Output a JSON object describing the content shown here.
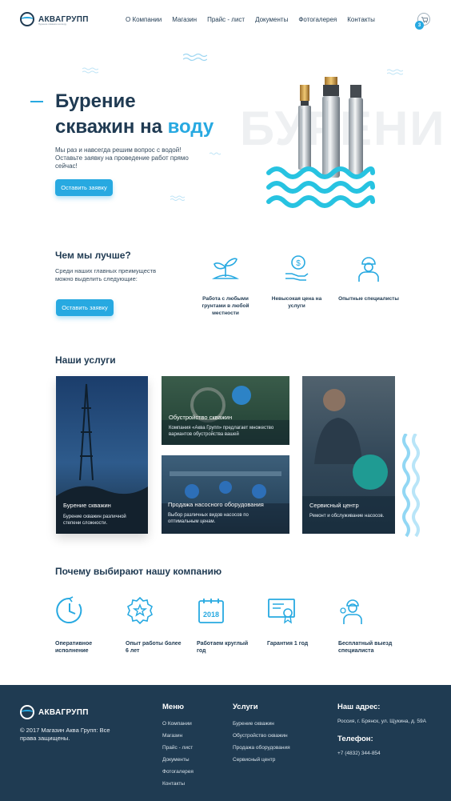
{
  "header": {
    "logo_text": "АКВАГРУПП",
    "logo_sub": "бурение скважин на воду",
    "nav": [
      "О Компании",
      "Магазин",
      "Прайс - лист",
      "Документы",
      "Фотогалерея",
      "Контакты"
    ],
    "cart_count": "3"
  },
  "hero": {
    "title_line1": "Бурение",
    "title_line2": "скважин на ",
    "title_accent": "воду",
    "description": "Мы раз и навсегда решим вопрос с водой! Оставьте заявку на проведение работ прямо сейчас!",
    "button": "Оставить заявку",
    "bg_word": "БУРЕНИ"
  },
  "advantages": {
    "title": "Чем мы лучше?",
    "description": "Среди наших главных преимуществ можно выделить следующие:",
    "button": "Оставить заявку",
    "items": [
      {
        "label": "Работа с любыми грунтами в любой местности",
        "icon": "sprout-icon"
      },
      {
        "label": "Невысокая цена на услуги",
        "icon": "money-hand-icon"
      },
      {
        "label": "Опытные специалисты",
        "icon": "worker-icon"
      }
    ]
  },
  "services": {
    "title": "Наши услуги",
    "cards": [
      {
        "title": "Бурение скважин",
        "desc": "Бурение скважин различной степени сложности."
      },
      {
        "title": "Обустройство скважин",
        "desc": "Компания «Аква Групп» предлагает множество вариантов обустройства вашей"
      },
      {
        "title": "Продажа насосного оборудования",
        "desc": "Выбор различных видов насосов по оптимальным ценам."
      },
      {
        "title": "Сервисный центр",
        "desc": "Ремонт и обслуживание насосов."
      }
    ]
  },
  "why": {
    "title": "Почему выбирают нашу компанию",
    "items": [
      {
        "label": "Оперативное исполнение",
        "icon": "clock-icon"
      },
      {
        "label": "Опыт работы более 6 лет",
        "icon": "star-badge-icon"
      },
      {
        "label": "Работаем круглый год",
        "icon": "calendar-icon",
        "icon_text": "2018"
      },
      {
        "label": "Гарантия 1 год",
        "icon": "certificate-icon"
      },
      {
        "label": "Бесплатный выезд специалиста",
        "icon": "specialist-icon"
      }
    ]
  },
  "footer": {
    "logo_text": "АКВАГРУПП",
    "copyright": "© 2017 Магазин Аква Групп: Все права защищены.",
    "menu_title": "Меню",
    "menu": [
      "О Компании",
      "Магазин",
      "Прайс - лист",
      "Документы",
      "Фотогалерея",
      "Контакты"
    ],
    "services_title": "Услуги",
    "services": [
      "Бурение скважин",
      "Обустройство скважин",
      "Продажа оборудования",
      "Сервисный центр"
    ],
    "address_title": "Наш адрес:",
    "address": "Россия, г. Брянск, ул. Щукина, д. 59А",
    "phone_title": "Телефон:",
    "phone": "+7 (4832) 344-854"
  },
  "colors": {
    "accent": "#27a9e1",
    "dark": "#1f3b52"
  }
}
